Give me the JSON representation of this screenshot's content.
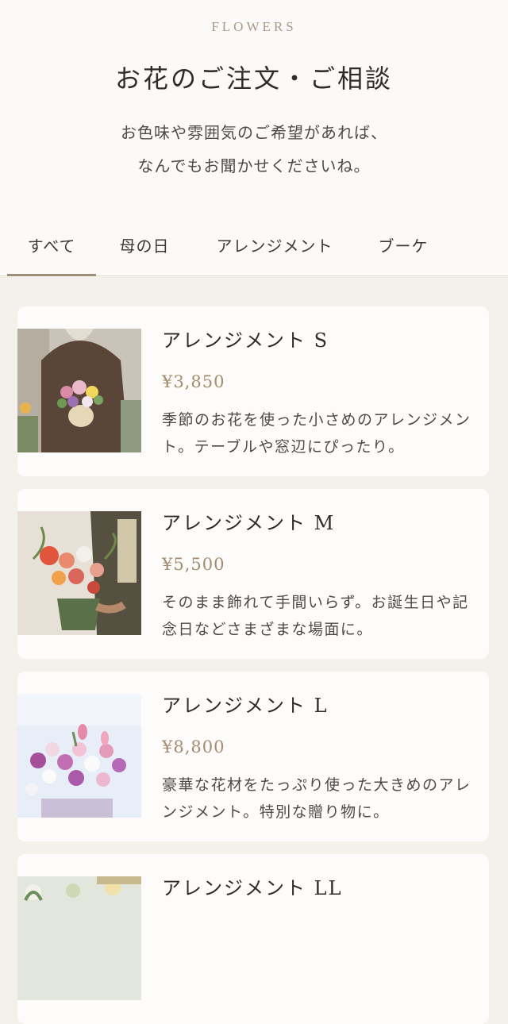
{
  "header": {
    "eyebrow": "FLOWERS",
    "title": "お花のご注文・ご相談",
    "subtitle_line1": "お色味や雰囲気のご希望があれば、",
    "subtitle_line2": "なんでもお聞かせくださいね。"
  },
  "tabs": [
    {
      "label": "すべて",
      "active": true
    },
    {
      "label": "母の日",
      "active": false
    },
    {
      "label": "アレンジメント",
      "active": false
    },
    {
      "label": "ブーケ",
      "active": false
    }
  ],
  "products": [
    {
      "name": "アレンジメント S",
      "price": "¥3,850",
      "desc": "季節のお花を使った小さめのアレンジメント。テーブルや窓辺にぴったり。"
    },
    {
      "name": "アレンジメント M",
      "price": "¥5,500",
      "desc": "そのまま飾れて手間いらず。お誕生日や記念日などさまざまな場面に。"
    },
    {
      "name": "アレンジメント L",
      "price": "¥8,800",
      "desc": "豪華な花材をたっぷり使った大きめのアレンジメント。特別な贈り物に。"
    },
    {
      "name": "アレンジメント LL",
      "price": "",
      "desc": ""
    }
  ],
  "colors": {
    "accent": "#9f8e79",
    "price": "#a38d6e",
    "background": "#f4f1ec",
    "card": "#fdfcfb"
  }
}
